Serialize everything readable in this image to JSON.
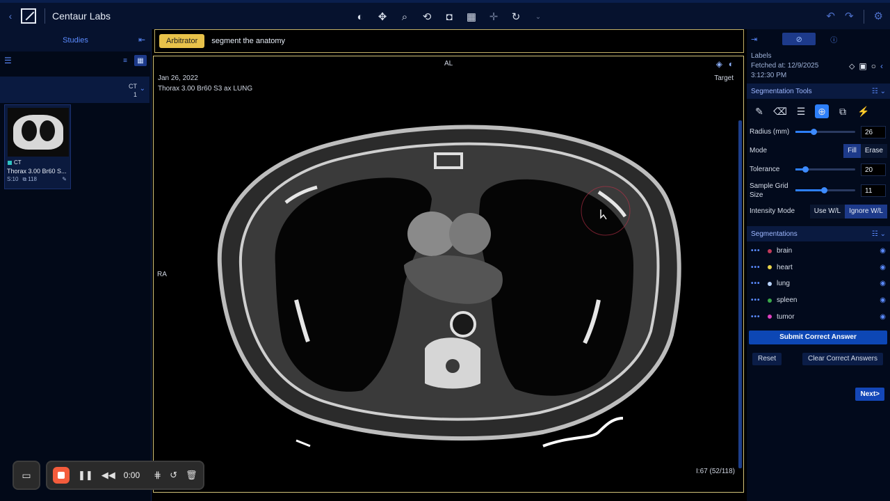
{
  "app": {
    "title": "Centaur Labs"
  },
  "toolbar": {
    "tools": [
      {
        "name": "contrast-icon",
        "glyph": "◐"
      },
      {
        "name": "pan-icon",
        "glyph": "✥"
      },
      {
        "name": "zoom-icon",
        "glyph": "⌕"
      },
      {
        "name": "rotate-3d-icon",
        "glyph": "⟲"
      },
      {
        "name": "camera-icon",
        "glyph": "◘"
      },
      {
        "name": "layout-icon",
        "glyph": "▦"
      },
      {
        "name": "crosshair-icon",
        "glyph": "✛"
      },
      {
        "name": "reset-icon",
        "glyph": "↻"
      }
    ]
  },
  "left_panel": {
    "header": "Studies",
    "modality": "CT",
    "modality_count": "1",
    "thumbnail": {
      "tag": "CT",
      "name": "Thorax 3.00 Br60 S...",
      "series": "S:10",
      "count": "118"
    }
  },
  "prompt": {
    "badge": "Arbitrator",
    "text": "segment the anatomy"
  },
  "viewer": {
    "date": "Jan 26, 2022",
    "series_desc": "Thorax 3.00 Br60 S3 ax LUNG",
    "orientation_top": "AL",
    "orientation_left": "RA",
    "target": "Target",
    "slice_info": "I:67 (52/118)"
  },
  "right_panel": {
    "labels_title": "Labels",
    "fetched": "Fetched at: 12/9/2025",
    "fetched_time": "3:12:30 PM",
    "seg_tools_title": "Segmentation Tools",
    "radius_label": "Radius (mm)",
    "radius_value": "26",
    "radius_level": 0.3,
    "mode_label": "Mode",
    "mode_fill": "Fill",
    "mode_erase": "Erase",
    "tolerance_label": "Tolerance",
    "tolerance_value": "20",
    "tolerance_level": 0.16,
    "sample_label": "Sample Grid Size",
    "sample_value": "11",
    "sample_level": 0.48,
    "intensity_label": "Intensity Mode",
    "use_wl": "Use W/L",
    "ignore_wl": "Ignore W/L",
    "segmentations_title": "Segmentations",
    "segments": [
      {
        "name": "brain",
        "color": "#c23a5a"
      },
      {
        "name": "heart",
        "color": "#e8d44a"
      },
      {
        "name": "lung",
        "color": "#b9d4ff"
      },
      {
        "name": "spleen",
        "color": "#3aa84a"
      },
      {
        "name": "tumor",
        "color": "#e040c0"
      }
    ],
    "submit": "Submit Correct Answer",
    "reset": "Reset",
    "clear": "Clear Correct Answers",
    "next": "Next>"
  },
  "recorder": {
    "time": "0:00"
  }
}
